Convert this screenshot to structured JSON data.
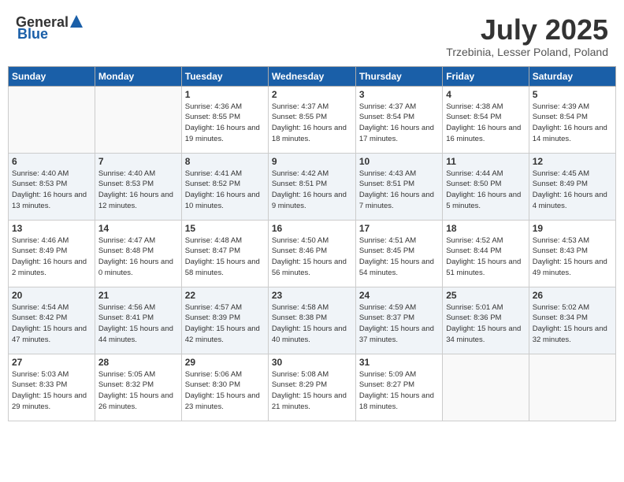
{
  "header": {
    "logo_general": "General",
    "logo_blue": "Blue",
    "title": "July 2025",
    "location": "Trzebinia, Lesser Poland, Poland"
  },
  "days_of_week": [
    "Sunday",
    "Monday",
    "Tuesday",
    "Wednesday",
    "Thursday",
    "Friday",
    "Saturday"
  ],
  "weeks": [
    [
      {
        "day": "",
        "info": ""
      },
      {
        "day": "",
        "info": ""
      },
      {
        "day": "1",
        "info": "Sunrise: 4:36 AM\nSunset: 8:55 PM\nDaylight: 16 hours and 19 minutes."
      },
      {
        "day": "2",
        "info": "Sunrise: 4:37 AM\nSunset: 8:55 PM\nDaylight: 16 hours and 18 minutes."
      },
      {
        "day": "3",
        "info": "Sunrise: 4:37 AM\nSunset: 8:54 PM\nDaylight: 16 hours and 17 minutes."
      },
      {
        "day": "4",
        "info": "Sunrise: 4:38 AM\nSunset: 8:54 PM\nDaylight: 16 hours and 16 minutes."
      },
      {
        "day": "5",
        "info": "Sunrise: 4:39 AM\nSunset: 8:54 PM\nDaylight: 16 hours and 14 minutes."
      }
    ],
    [
      {
        "day": "6",
        "info": "Sunrise: 4:40 AM\nSunset: 8:53 PM\nDaylight: 16 hours and 13 minutes."
      },
      {
        "day": "7",
        "info": "Sunrise: 4:40 AM\nSunset: 8:53 PM\nDaylight: 16 hours and 12 minutes."
      },
      {
        "day": "8",
        "info": "Sunrise: 4:41 AM\nSunset: 8:52 PM\nDaylight: 16 hours and 10 minutes."
      },
      {
        "day": "9",
        "info": "Sunrise: 4:42 AM\nSunset: 8:51 PM\nDaylight: 16 hours and 9 minutes."
      },
      {
        "day": "10",
        "info": "Sunrise: 4:43 AM\nSunset: 8:51 PM\nDaylight: 16 hours and 7 minutes."
      },
      {
        "day": "11",
        "info": "Sunrise: 4:44 AM\nSunset: 8:50 PM\nDaylight: 16 hours and 5 minutes."
      },
      {
        "day": "12",
        "info": "Sunrise: 4:45 AM\nSunset: 8:49 PM\nDaylight: 16 hours and 4 minutes."
      }
    ],
    [
      {
        "day": "13",
        "info": "Sunrise: 4:46 AM\nSunset: 8:49 PM\nDaylight: 16 hours and 2 minutes."
      },
      {
        "day": "14",
        "info": "Sunrise: 4:47 AM\nSunset: 8:48 PM\nDaylight: 16 hours and 0 minutes."
      },
      {
        "day": "15",
        "info": "Sunrise: 4:48 AM\nSunset: 8:47 PM\nDaylight: 15 hours and 58 minutes."
      },
      {
        "day": "16",
        "info": "Sunrise: 4:50 AM\nSunset: 8:46 PM\nDaylight: 15 hours and 56 minutes."
      },
      {
        "day": "17",
        "info": "Sunrise: 4:51 AM\nSunset: 8:45 PM\nDaylight: 15 hours and 54 minutes."
      },
      {
        "day": "18",
        "info": "Sunrise: 4:52 AM\nSunset: 8:44 PM\nDaylight: 15 hours and 51 minutes."
      },
      {
        "day": "19",
        "info": "Sunrise: 4:53 AM\nSunset: 8:43 PM\nDaylight: 15 hours and 49 minutes."
      }
    ],
    [
      {
        "day": "20",
        "info": "Sunrise: 4:54 AM\nSunset: 8:42 PM\nDaylight: 15 hours and 47 minutes."
      },
      {
        "day": "21",
        "info": "Sunrise: 4:56 AM\nSunset: 8:41 PM\nDaylight: 15 hours and 44 minutes."
      },
      {
        "day": "22",
        "info": "Sunrise: 4:57 AM\nSunset: 8:39 PM\nDaylight: 15 hours and 42 minutes."
      },
      {
        "day": "23",
        "info": "Sunrise: 4:58 AM\nSunset: 8:38 PM\nDaylight: 15 hours and 40 minutes."
      },
      {
        "day": "24",
        "info": "Sunrise: 4:59 AM\nSunset: 8:37 PM\nDaylight: 15 hours and 37 minutes."
      },
      {
        "day": "25",
        "info": "Sunrise: 5:01 AM\nSunset: 8:36 PM\nDaylight: 15 hours and 34 minutes."
      },
      {
        "day": "26",
        "info": "Sunrise: 5:02 AM\nSunset: 8:34 PM\nDaylight: 15 hours and 32 minutes."
      }
    ],
    [
      {
        "day": "27",
        "info": "Sunrise: 5:03 AM\nSunset: 8:33 PM\nDaylight: 15 hours and 29 minutes."
      },
      {
        "day": "28",
        "info": "Sunrise: 5:05 AM\nSunset: 8:32 PM\nDaylight: 15 hours and 26 minutes."
      },
      {
        "day": "29",
        "info": "Sunrise: 5:06 AM\nSunset: 8:30 PM\nDaylight: 15 hours and 23 minutes."
      },
      {
        "day": "30",
        "info": "Sunrise: 5:08 AM\nSunset: 8:29 PM\nDaylight: 15 hours and 21 minutes."
      },
      {
        "day": "31",
        "info": "Sunrise: 5:09 AM\nSunset: 8:27 PM\nDaylight: 15 hours and 18 minutes."
      },
      {
        "day": "",
        "info": ""
      },
      {
        "day": "",
        "info": ""
      }
    ]
  ]
}
